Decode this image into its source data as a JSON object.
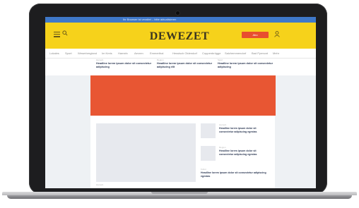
{
  "top_banner": {
    "text": "Ihr Browser ist veraltet – bitte aktualisieren"
  },
  "header": {
    "brand": "DEWEZET",
    "subscribe_label": "Abo",
    "menu_icon": "hamburger-menu-icon",
    "search_icon": "search-icon",
    "user_icon": "user-icon",
    "accent_color": "#f6d21b",
    "button_color": "#e84e2f"
  },
  "nav": {
    "items": [
      "Lokales",
      "Sport",
      "Weserbergland",
      "Im Kreis",
      "Hameln",
      "Aerzen",
      "Emmerthal",
      "Hessisch Oldendorf",
      "Coppenbrügge",
      "Salzhemmendorf",
      "Bad Pyrmont",
      "Mehr"
    ]
  },
  "teasers": [
    {
      "kicker": "Hameln",
      "headline": "Headline lorem ipsum dolor sit consectetur adipiscing"
    },
    {
      "kicker": "Region",
      "headline": "Headline lorem ipsum dolor sit consectetur adipiscing elit"
    },
    {
      "kicker": "Sport",
      "headline": "Headline lorem ipsum dolor sit consectetur adipiscing"
    }
  ],
  "ad": {
    "color": "#e85633"
  },
  "side_articles": [
    {
      "kicker": "Hameln",
      "headline": "Headline lorem ipsum dolor sit consectetur adipiscing egestas"
    },
    {
      "kicker": "Region",
      "headline": "Headline lorem ipsum dolor sit consectetur adipiscing egestas"
    },
    {
      "kicker": "Kultur",
      "headline": "Headline lorem ipsum dolor sit consectetur adipiscing egestas"
    }
  ],
  "feature": {
    "kicker": "Hameln"
  }
}
